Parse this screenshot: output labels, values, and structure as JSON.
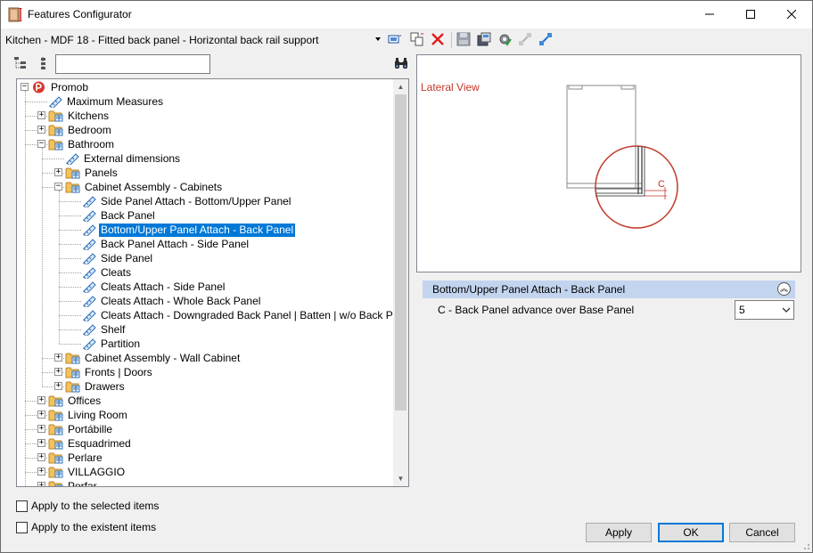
{
  "window": {
    "title": "Features Configurator",
    "controls": {
      "minimize": "minimize-icon",
      "maximize": "maximize-icon",
      "close": "close-icon"
    }
  },
  "toolbar": {
    "preset": "Kitchen - MDF 18 - Fitted back panel - Horizontal back rail support",
    "icons": [
      "screen-icon",
      "copy-icon",
      "delete-icon",
      "save-icon",
      "save-as-icon",
      "settings-icon",
      "link-icon",
      "link-blue-icon"
    ]
  },
  "tree": {
    "search": {
      "value": "",
      "placeholder": ""
    },
    "nodes": [
      {
        "label": "Promob",
        "level": 0,
        "icon": "promob",
        "expander": "-"
      },
      {
        "label": "Maximum Measures",
        "level": 1,
        "icon": "pencil",
        "expander": ""
      },
      {
        "label": "Kitchens",
        "level": 1,
        "icon": "folder",
        "expander": "+"
      },
      {
        "label": "Bedroom",
        "level": 1,
        "icon": "folder",
        "expander": "+"
      },
      {
        "label": "Bathroom",
        "level": 1,
        "icon": "folder-open",
        "expander": "-"
      },
      {
        "label": "External dimensions",
        "level": 2,
        "icon": "pencil",
        "expander": ""
      },
      {
        "label": "Panels",
        "level": 2,
        "icon": "folder",
        "expander": "+"
      },
      {
        "label": "Cabinet Assembly - Cabinets",
        "level": 2,
        "icon": "folder-open",
        "expander": "-"
      },
      {
        "label": "Side Panel Attach - Bottom/Upper Panel",
        "level": 3,
        "icon": "pencil",
        "expander": ""
      },
      {
        "label": "Back Panel",
        "level": 3,
        "icon": "pencil",
        "expander": ""
      },
      {
        "label": "Bottom/Upper Panel Attach - Back Panel",
        "level": 3,
        "icon": "pencil",
        "expander": "",
        "selected": true
      },
      {
        "label": "Back Panel Attach - Side Panel",
        "level": 3,
        "icon": "pencil",
        "expander": ""
      },
      {
        "label": "Side Panel",
        "level": 3,
        "icon": "pencil",
        "expander": ""
      },
      {
        "label": "Cleats",
        "level": 3,
        "icon": "pencil",
        "expander": ""
      },
      {
        "label": "Cleats Attach - Side Panel",
        "level": 3,
        "icon": "pencil",
        "expander": ""
      },
      {
        "label": "Cleats Attach - Whole Back Panel",
        "level": 3,
        "icon": "pencil",
        "expander": ""
      },
      {
        "label": "Cleats Attach - Downgraded Back Panel | Batten | w/o Back Panel",
        "level": 3,
        "icon": "pencil",
        "expander": ""
      },
      {
        "label": "Shelf",
        "level": 3,
        "icon": "pencil",
        "expander": ""
      },
      {
        "label": "Partition",
        "level": 3,
        "icon": "pencil",
        "expander": ""
      },
      {
        "label": "Cabinet Assembly - Wall Cabinet",
        "level": 2,
        "icon": "folder",
        "expander": "+"
      },
      {
        "label": "Fronts | Doors",
        "level": 2,
        "icon": "folder",
        "expander": "+"
      },
      {
        "label": "Drawers",
        "level": 2,
        "icon": "folder",
        "expander": "+"
      },
      {
        "label": "Offices",
        "level": 1,
        "icon": "folder",
        "expander": "+"
      },
      {
        "label": "Living Room",
        "level": 1,
        "icon": "folder",
        "expander": "+"
      },
      {
        "label": "Portábille",
        "level": 1,
        "icon": "folder",
        "expander": "+"
      },
      {
        "label": "Esquadrimed",
        "level": 1,
        "icon": "folder",
        "expander": "+"
      },
      {
        "label": "Perlare",
        "level": 1,
        "icon": "folder",
        "expander": "+"
      },
      {
        "label": "VILLAGGIO",
        "level": 1,
        "icon": "folder",
        "expander": "+"
      },
      {
        "label": "Porfar",
        "level": 1,
        "icon": "folder",
        "expander": "+"
      }
    ]
  },
  "preview": {
    "view_label": "Lateral View",
    "dimension_label": "C"
  },
  "properties": {
    "header": "Bottom/Upper Panel Attach - Back Panel",
    "rows": [
      {
        "label": "C - Back Panel advance over Base Panel",
        "value": "5"
      }
    ]
  },
  "options": {
    "apply_selected": "Apply to the selected items",
    "apply_existent": "Apply to the existent items"
  },
  "buttons": {
    "apply": "Apply",
    "ok": "OK",
    "cancel": "Cancel"
  },
  "colors": {
    "selection": "#0078d7",
    "prop_header": "#c3d4ef",
    "accent_red": "#c0392b"
  }
}
